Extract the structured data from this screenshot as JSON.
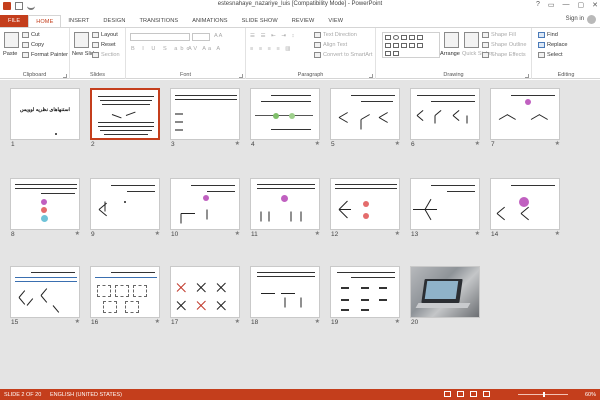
{
  "window": {
    "title": "estesnahaye_nazariye_luis [Compatibility Mode] - PowerPoint",
    "signin": "Sign in",
    "controls": [
      "?",
      "▭",
      "—",
      "▢",
      "✕"
    ]
  },
  "tabs": [
    "FILE",
    "HOME",
    "INSERT",
    "DESIGN",
    "TRANSITIONS",
    "ANIMATIONS",
    "SLIDE SHOW",
    "REVIEW",
    "VIEW"
  ],
  "active_tab": "HOME",
  "ribbon": {
    "clipboard": {
      "label": "Clipboard",
      "paste": "Paste",
      "cut": "Cut",
      "copy": "Copy",
      "format_painter": "Format Painter"
    },
    "slides": {
      "label": "Slides",
      "new_slide": "New Slide",
      "layout": "Layout",
      "reset": "Reset",
      "section": "Section"
    },
    "font": {
      "label": "Font"
    },
    "paragraph": {
      "label": "Paragraph",
      "text_direction": "Text Direction",
      "align_text": "Align Text",
      "convert": "Convert to SmartArt"
    },
    "drawing": {
      "label": "Drawing",
      "arrange": "Arrange",
      "quick_styles": "Quick Styles",
      "shape_fill": "Shape Fill",
      "shape_outline": "Shape Outline",
      "shape_effects": "Shape Effects"
    },
    "editing": {
      "label": "Editing",
      "find": "Find",
      "replace": "Replace",
      "select": "Select"
    }
  },
  "slides": [
    {
      "num": "1",
      "title_text": "استنهاهای نظریه لوویس"
    },
    {
      "num": "2"
    },
    {
      "num": "3"
    },
    {
      "num": "4"
    },
    {
      "num": "5"
    },
    {
      "num": "6"
    },
    {
      "num": "7"
    },
    {
      "num": "8"
    },
    {
      "num": "9"
    },
    {
      "num": "10"
    },
    {
      "num": "11"
    },
    {
      "num": "12"
    },
    {
      "num": "13"
    },
    {
      "num": "14"
    },
    {
      "num": "15"
    },
    {
      "num": "16"
    },
    {
      "num": "17"
    },
    {
      "num": "18"
    },
    {
      "num": "19"
    },
    {
      "num": "20"
    }
  ],
  "selected_slide": "2",
  "transition_marker": "★",
  "status": {
    "slide_info": "SLIDE 2 OF 20",
    "language": "ENGLISH (UNITED STATES)",
    "zoom": "60%"
  }
}
